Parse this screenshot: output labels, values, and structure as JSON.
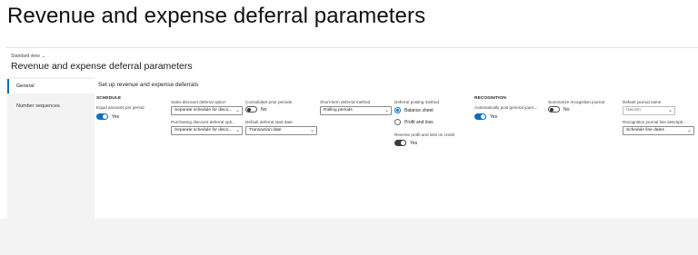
{
  "slide": {
    "title": "Revenue and expense deferral parameters"
  },
  "header": {
    "view": "Standard view",
    "title": "Revenue and expense deferral parameters"
  },
  "nav": {
    "items": [
      {
        "label": "General"
      },
      {
        "label": "Number sequences"
      }
    ]
  },
  "main": {
    "section_title": "Set up revenue and expense deferrals",
    "schedule": {
      "heading": "SCHEDULE",
      "equal_amounts": {
        "label": "Equal amounts per period",
        "value": "Yes"
      }
    },
    "sales_discount": {
      "label": "Sales discount deferral option",
      "value": "Separate schedule for disco..."
    },
    "purchasing_discount": {
      "label": "Purchasing discount deferral opti...",
      "value": "Separate schedule for disco..."
    },
    "consolidate": {
      "label": "Consolidate prior periods",
      "value": "No"
    },
    "default_start": {
      "label": "Default deferral start date",
      "value": "Transaction date"
    },
    "short_term": {
      "label": "Short-term deferral method",
      "value": "Rolling periods"
    },
    "posting_method": {
      "label": "Deferral posting method",
      "options": [
        "Balance sheet",
        "Profit and loss"
      ],
      "selected": "Balance sheet"
    },
    "reverse_pl": {
      "label": "Reverse profit and loss on credit",
      "value": "Yes"
    },
    "recognition": {
      "heading": "RECOGNITION",
      "auto_post": {
        "label": "Automatically post general journ...",
        "value": "Yes"
      }
    },
    "summarize": {
      "label": "Summarize recognition journal",
      "value": "No"
    },
    "default_journal": {
      "label": "Default journal name",
      "value": "GenJrn"
    },
    "line_description": {
      "label": "Recognition journal line descripti...",
      "value": "Schedule line dates"
    }
  }
}
